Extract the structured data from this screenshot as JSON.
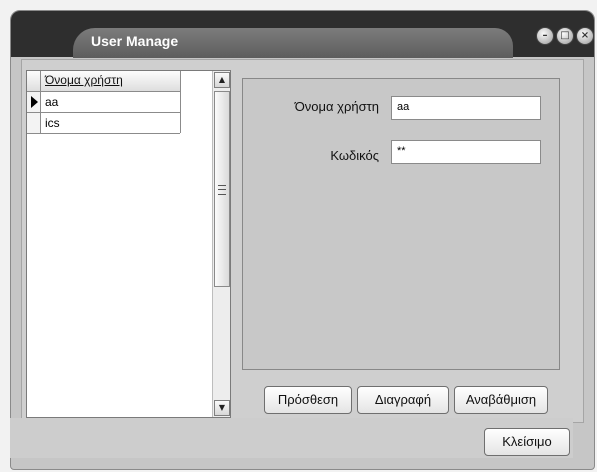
{
  "window": {
    "title": "User Manage",
    "accent": "#2e2e2e"
  },
  "controls": {
    "minimize_icon": "minimize-icon",
    "maximize_icon": "maximize-icon",
    "close_icon": "close-icon"
  },
  "users_grid": {
    "header": "Όνομα χρήστη",
    "rows": [
      {
        "name": "aa",
        "selected": true
      },
      {
        "name": "ics",
        "selected": false
      }
    ]
  },
  "form": {
    "username_label": "Όνομα χρήστη",
    "username_value": "aa",
    "password_label": "Κωδικός",
    "password_value": "**"
  },
  "buttons": {
    "add": "Πρόσθεση",
    "delete": "Διαγραφή",
    "update": "Αναβάθμιση",
    "close": "Κλείσιμο"
  }
}
